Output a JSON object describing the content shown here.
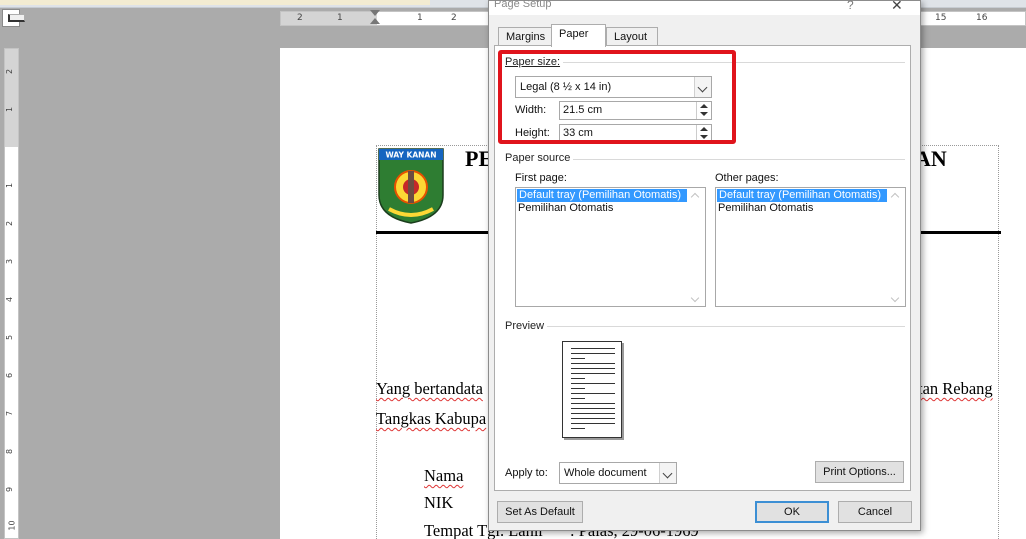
{
  "ruler": {
    "h_left_marks": [
      "2",
      "1",
      "1",
      "2"
    ],
    "h_right_marks": [
      "15",
      "16"
    ],
    "v_marks": [
      "2",
      "1",
      "1",
      "2",
      "3",
      "4",
      "5",
      "6",
      "7",
      "8",
      "9",
      "10"
    ]
  },
  "document": {
    "heading_left": "PE",
    "heading_right": "AN",
    "logo_text": "WAY KANAN",
    "line1_left": "Yang bertandata",
    "line1_right": "tan Rebang",
    "line2": "Tangkas Kabupa",
    "field_nama": "Nama",
    "field_nik": "NIK",
    "field_ttl": "Tempat Tgl. Lahir",
    "field_ttl_value": ": Palas, 29-06-1969"
  },
  "dialog": {
    "title": "Page Setup",
    "help": "?",
    "close": "✕",
    "tabs": [
      "Margins",
      "Paper",
      "Layout"
    ],
    "active_tab": "Paper",
    "paper_size": {
      "group_label": "Paper size:",
      "selected": "Legal (8 ½ x 14 in)",
      "width_label": "Width:",
      "width_value": "21.5 cm",
      "height_label": "Height:",
      "height_value": "33 cm"
    },
    "paper_source": {
      "group_label": "Paper source",
      "first_page_label": "First page:",
      "first_page_items": [
        "Default tray (Pemilihan Otomatis)",
        "Pemilihan Otomatis"
      ],
      "other_pages_label": "Other pages:",
      "other_pages_items": [
        "Default tray (Pemilihan Otomatis)",
        "Pemilihan Otomatis"
      ]
    },
    "preview": {
      "label": "Preview"
    },
    "apply_to": {
      "label": "Apply to:",
      "value": "Whole document"
    },
    "buttons": {
      "print_options": "Print Options...",
      "set_default": "Set As Default",
      "ok": "OK",
      "cancel": "Cancel"
    }
  },
  "colors": {
    "highlight": "#e0141c",
    "selection": "#3399ff",
    "accent": "#3c8fd4"
  }
}
